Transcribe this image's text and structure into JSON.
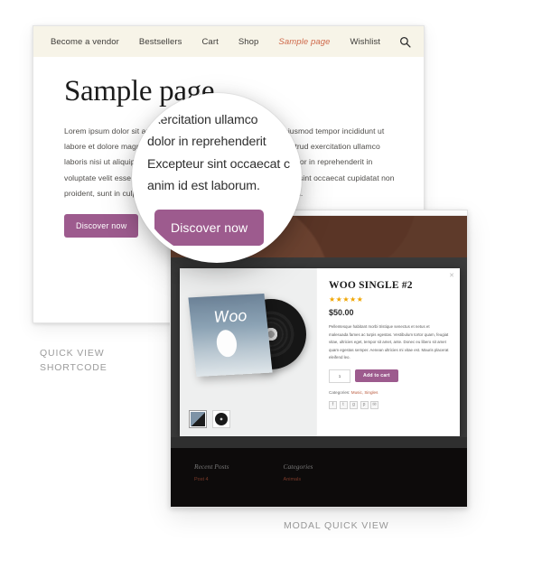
{
  "page_card": {
    "nav": {
      "items": [
        {
          "label": "Become a vendor",
          "active": false
        },
        {
          "label": "Bestsellers",
          "active": false
        },
        {
          "label": "Cart",
          "active": false
        },
        {
          "label": "Shop",
          "active": false
        },
        {
          "label": "Sample page",
          "active": true
        },
        {
          "label": "Wishlist",
          "active": false
        }
      ],
      "search_icon": "search-icon"
    },
    "title": "Sample page",
    "paragraph": "Lorem ipsum dolor sit amet, consectetur adipiscing elit, sed do eiusmod tempor incididunt ut labore et dolore magna aliqua. Ut enim ad minim veniam, quis nostrud exercitation ullamco laboris nisi ut aliquip ex ea commodo consequat. Duis aute irure dolor in reprehenderit in voluptate velit esse cillum dolore eu fugiat nulla pariatur. Excepteur sint occaecat cupidatat non proident, sunt in culpa qui officia deserunt mollit anim id est laborum.",
    "discover_button": "Discover now"
  },
  "lens": {
    "line1": "exercitation ullamco",
    "line2": "dolor in reprehenderit",
    "line3": "Excepteur sint occaecat c",
    "line4": "anim id est laborum.",
    "button": "Discover now"
  },
  "modal": {
    "close_icon": "close-icon",
    "product": {
      "title": "WOO SINGLE #2",
      "stars": "★★★★★",
      "price": "$50.00",
      "description": "Pellentesque habitant morbi tristique senectus et netus et malesuada fames ac turpis egestas. Vestibulum tortor quam, feugiat vitae, ultricies eget, tempor sit amet, ante. Donec eu libero sit amet quam egestas semper. Aenean ultricies mi vitae est. Mauris placerat eleifend leo.",
      "quantity": "1",
      "add_to_cart": "Add to cart",
      "categories_label": "Categories:",
      "categories_value": "Music, Singles",
      "album_art_text": "Woo",
      "social_icons": [
        "facebook-icon",
        "twitter-icon",
        "google-plus-icon",
        "pinterest-icon",
        "email-icon"
      ],
      "thumbnails": [
        "album-sleeve-thumbnail",
        "vinyl-record-thumbnail"
      ]
    },
    "footer": {
      "col1_heading": "Recent Posts",
      "col1_link": "Post 4",
      "col2_heading": "Categories",
      "col2_link": "Animals"
    }
  },
  "captions": {
    "left_line1": "QUICK VIEW",
    "left_line2": "SHORTCODE",
    "bottom": "MODAL QUICK VIEW"
  },
  "colors": {
    "accent_purple": "#9d5b8e",
    "nav_bg": "#f7f4e8",
    "active_link": "#cf6a4b",
    "star": "#f0a500",
    "caption": "#9b9b9b"
  }
}
